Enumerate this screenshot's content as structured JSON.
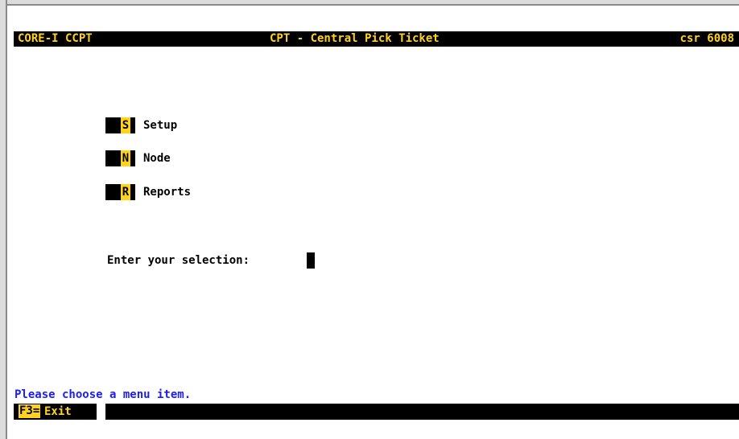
{
  "header": {
    "left": "CORE-I CCPT",
    "center": "CPT - Central Pick Ticket",
    "right": "csr 6008"
  },
  "menu": [
    {
      "key": "S",
      "label": "Setup"
    },
    {
      "key": "N",
      "label": "Node"
    },
    {
      "key": "R",
      "label": "Reports"
    }
  ],
  "prompt": {
    "label": "Enter your selection:"
  },
  "status": {
    "message": "Please choose a menu item."
  },
  "function_keys": [
    {
      "key": "F3=",
      "label": "Exit"
    }
  ],
  "colors": {
    "accent": "#ffd21f",
    "status_text": "#1c1cff",
    "bar": "#000000"
  }
}
